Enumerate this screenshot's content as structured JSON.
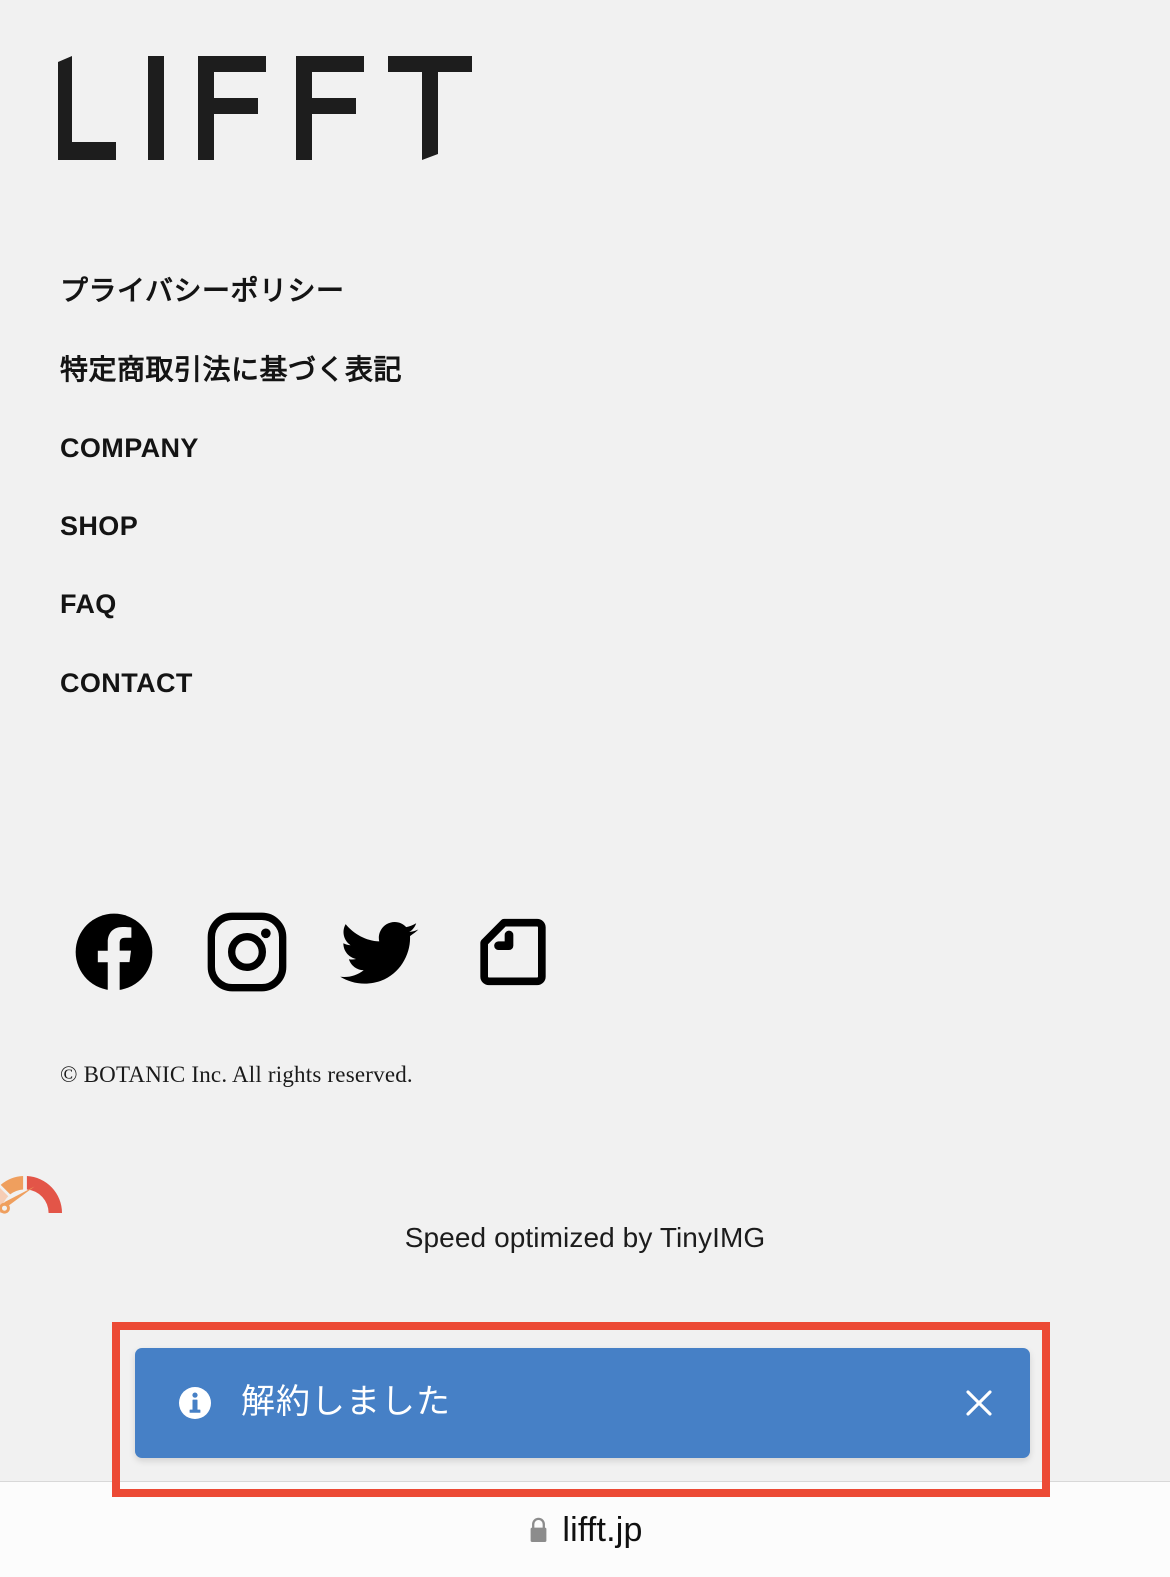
{
  "site": {
    "logo_text": "LIFFT",
    "background_color": "#f1f1f1"
  },
  "footer": {
    "nav_items": [
      {
        "label": "プライバシーポリシー",
        "lang": "jp"
      },
      {
        "label": "特定商取引法に基づく表記",
        "lang": "jp"
      },
      {
        "label": "COMPANY",
        "lang": "en"
      },
      {
        "label": "SHOP",
        "lang": "en"
      },
      {
        "label": "FAQ",
        "lang": "en"
      },
      {
        "label": "CONTACT",
        "lang": "en"
      }
    ],
    "social_links": [
      {
        "icon": "facebook-icon",
        "name": "Facebook"
      },
      {
        "icon": "instagram-icon",
        "name": "Instagram"
      },
      {
        "icon": "twitter-icon",
        "name": "Twitter"
      },
      {
        "icon": "note-icon",
        "name": "note"
      }
    ],
    "copyright": "© BOTANIC Inc. All rights reserved."
  },
  "tinyimg": {
    "icon": "speed-gauge-icon",
    "text": "Speed optimized by TinyIMG",
    "gauge_colors": [
      "#f6cdb5",
      "#ef9f5e",
      "#e35548"
    ]
  },
  "toast": {
    "icon": "info-circle-icon",
    "message": "解約しました",
    "close_label": "×",
    "background_color": "#4680c6",
    "text_color": "#ffffff"
  },
  "highlight": {
    "color": "#ec4a35",
    "target": "toast"
  },
  "browser": {
    "lock_icon": "lock-icon",
    "url": "lifft.jp"
  }
}
